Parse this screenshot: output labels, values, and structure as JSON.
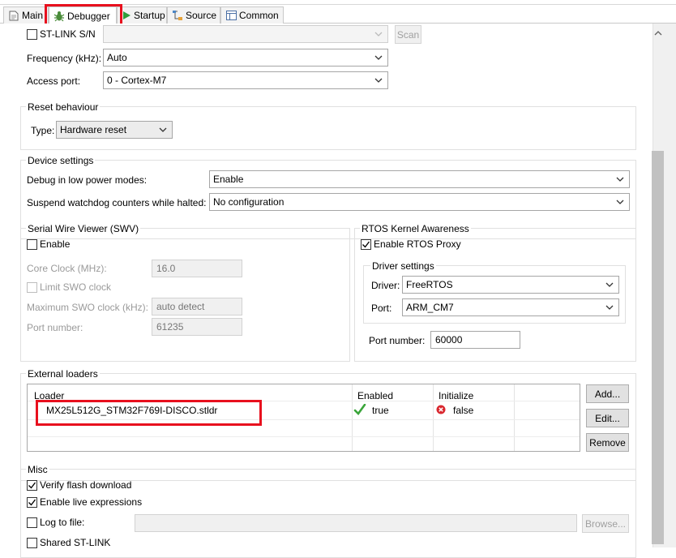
{
  "tabs": {
    "main": "Main",
    "debugger": "Debugger",
    "startup": "Startup",
    "source": "Source",
    "common": "Common"
  },
  "connection": {
    "stlink_sn_label": "ST-LINK S/N",
    "stlink_sn_value": "",
    "scan_label": "Scan",
    "frequency_label": "Frequency (kHz):",
    "frequency_value": "Auto",
    "access_port_label": "Access port:",
    "access_port_value": "0 - Cortex-M7"
  },
  "reset": {
    "title": "Reset behaviour",
    "type_label": "Type:",
    "type_value": "Hardware reset"
  },
  "device": {
    "title": "Device settings",
    "low_power_label": "Debug in low power modes:",
    "low_power_value": "Enable",
    "watchdog_label": "Suspend watchdog counters while halted:",
    "watchdog_value": "No configuration"
  },
  "swv": {
    "title": "Serial Wire Viewer (SWV)",
    "enable_label": "Enable",
    "enable_checked": false,
    "core_clock_label": "Core Clock (MHz):",
    "core_clock_value": "16.0",
    "limit_swo_label": "Limit SWO clock",
    "max_swo_label": "Maximum SWO clock (kHz):",
    "max_swo_value": "auto detect",
    "port_label": "Port number:",
    "port_value": "61235"
  },
  "rtos": {
    "title": "RTOS Kernel Awareness",
    "enable_proxy_label": "Enable RTOS Proxy",
    "enable_proxy_checked": true,
    "driver_settings_title": "Driver settings",
    "driver_label": "Driver:",
    "driver_value": "FreeRTOS",
    "port_label": "Port:",
    "port_value": "ARM_CM7",
    "port_number_label": "Port number:",
    "port_number_value": "60000"
  },
  "loaders": {
    "title": "External loaders",
    "columns": [
      "Loader",
      "Enabled",
      "Initialize"
    ],
    "rows": [
      {
        "loader": "MX25L512G_STM32F769I-DISCO.stldr",
        "enabled": "true",
        "initialize": "false"
      }
    ],
    "add_label": "Add...",
    "edit_label": "Edit...",
    "remove_label": "Remove"
  },
  "misc": {
    "title": "Misc",
    "verify_label": "Verify flash download",
    "verify_checked": true,
    "live_label": "Enable live expressions",
    "live_checked": true,
    "log_label": "Log to file:",
    "log_checked": false,
    "log_value": "",
    "browse_label": "Browse...",
    "shared_label": "Shared ST-LINK",
    "shared_checked": false
  },
  "colors": {
    "highlight": "#e8101e",
    "check_green": "#3aa53a",
    "error_red": "#d9272e",
    "startup_green": "#2f9e3c"
  }
}
